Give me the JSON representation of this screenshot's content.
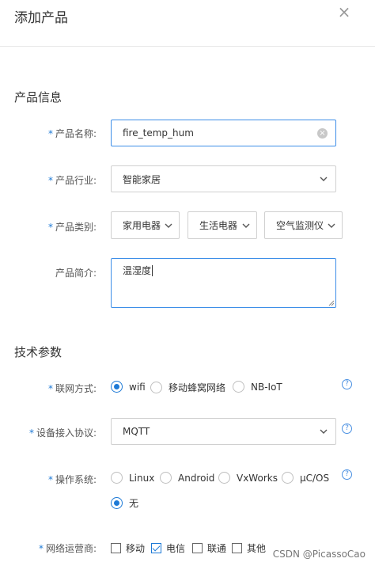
{
  "dialog": {
    "title": "添加产品",
    "close_glyph": "×"
  },
  "sections": {
    "product_info": "产品信息",
    "tech_params": "技术参数"
  },
  "required_mark": "*",
  "product_name": {
    "label": "产品名称:",
    "value": "fire_temp_hum",
    "clear_glyph": "×"
  },
  "industry": {
    "label": "产品行业:",
    "value": "智能家居"
  },
  "category": {
    "label": "产品类别:",
    "level1": "家用电器",
    "level2": "生活电器",
    "level3": "空气监测仪"
  },
  "description": {
    "label": "产品简介:",
    "value": "温湿度"
  },
  "network": {
    "label": "联网方式:",
    "options": [
      "wifi",
      "移动蜂窝网络",
      "NB-IoT"
    ],
    "selected": "wifi"
  },
  "protocol": {
    "label": "设备接入协议:",
    "value": "MQTT"
  },
  "os": {
    "label": "操作系统:",
    "options": [
      "Linux",
      "Android",
      "VxWorks",
      "μC/OS",
      "无"
    ],
    "selected": "无"
  },
  "carrier": {
    "label": "网络运营商:",
    "options": [
      "移动",
      "电信",
      "联通",
      "其他"
    ],
    "checked": [
      "电信"
    ]
  },
  "help_glyph": "?",
  "watermark": "CSDN @PicassoCao"
}
